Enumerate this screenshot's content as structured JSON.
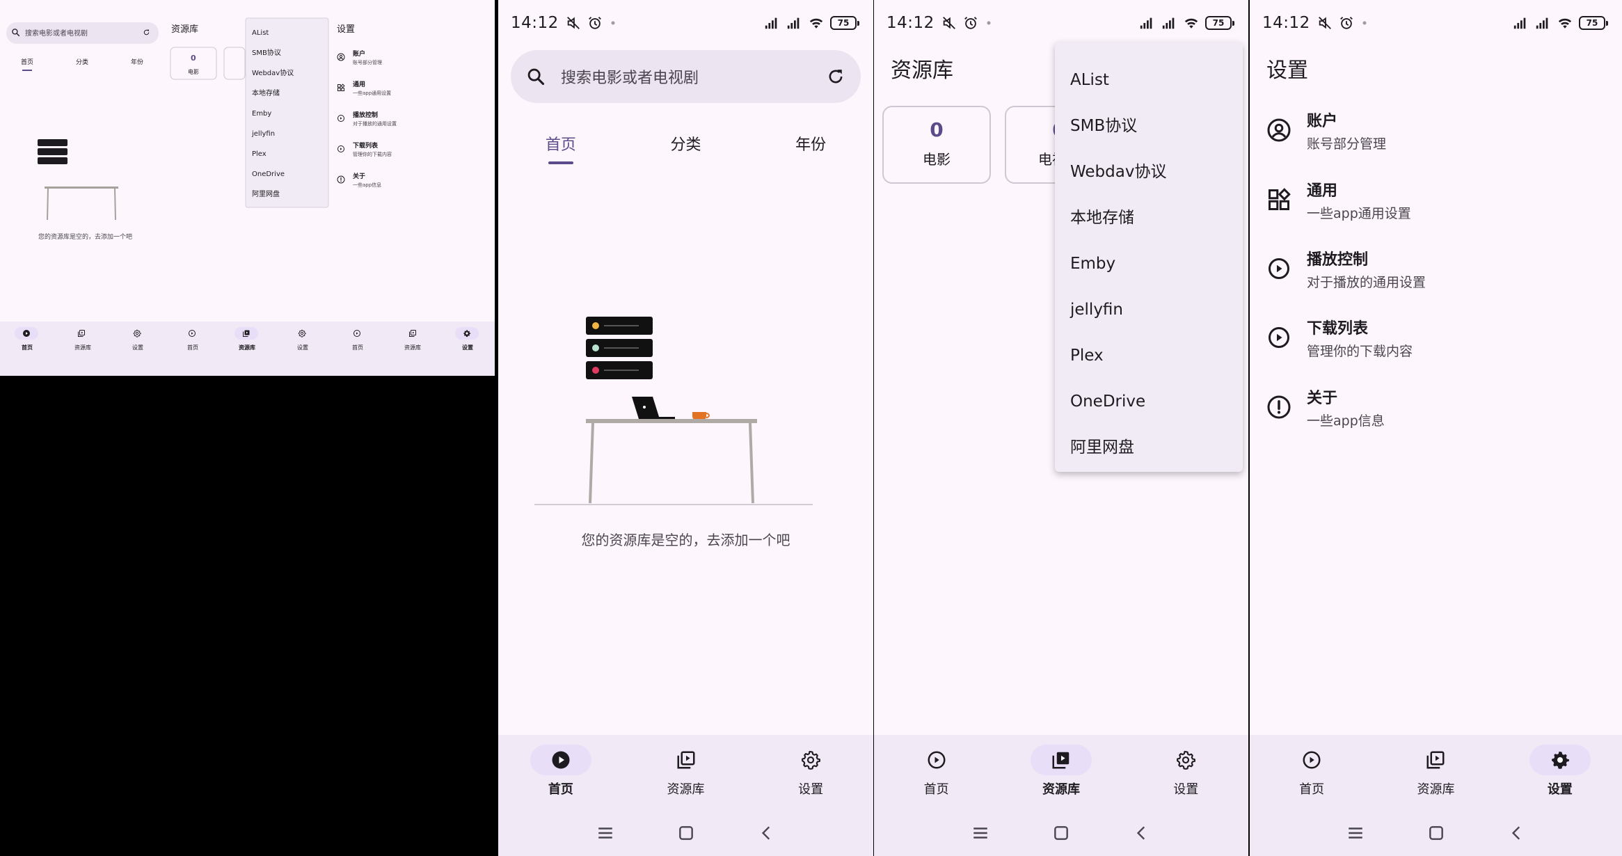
{
  "status": {
    "time": "14:12",
    "battery": "75"
  },
  "nav": {
    "home": "首页",
    "library": "资源库",
    "settings": "设置"
  },
  "home": {
    "search_placeholder": "搜索电影或者电视剧",
    "tabs": [
      "首页",
      "分类",
      "年份"
    ],
    "empty_text": "您的资源库是空的，去添加一个吧"
  },
  "library": {
    "title": "资源库",
    "cards": [
      {
        "count": "0",
        "label": "电影"
      },
      {
        "count": "0",
        "label": "电视剧"
      }
    ],
    "menu": [
      "AList",
      "SMB协议",
      "Webdav协议",
      "本地存储",
      "Emby",
      "jellyfin",
      "Plex",
      "OneDrive",
      "阿里网盘"
    ]
  },
  "settings": {
    "title": "设置",
    "items": [
      {
        "title": "账户",
        "subtitle": "账号部分管理",
        "icon": "account-circle-icon"
      },
      {
        "title": "通用",
        "subtitle": "一些app通用设置",
        "icon": "widgets-icon"
      },
      {
        "title": "播放控制",
        "subtitle": "对于播放的通用设置",
        "icon": "play-circle-icon"
      },
      {
        "title": "下载列表",
        "subtitle": "管理你的下载内容",
        "icon": "play-circle-icon"
      },
      {
        "title": "关于",
        "subtitle": "一些app信息",
        "icon": "info-icon"
      }
    ]
  },
  "colors": {
    "background": "#fdf6fd",
    "accent": "#5b4b8a",
    "nav_bg": "#f1eaf6",
    "nav_indicator": "#e8def8",
    "menu_bg": "#f1ebf5"
  }
}
